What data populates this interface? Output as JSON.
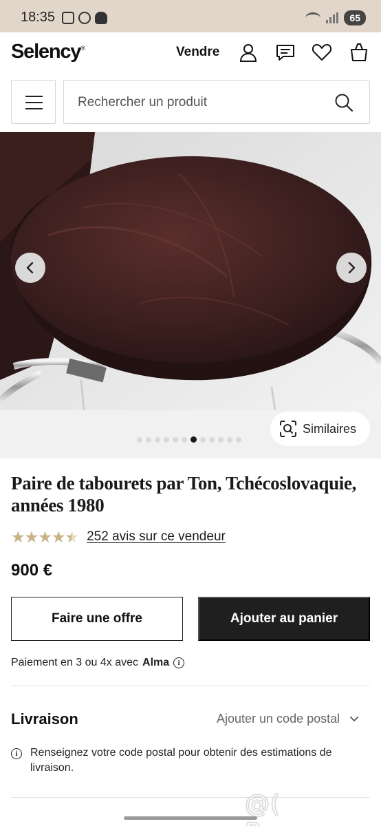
{
  "status_bar": {
    "time": "18:35",
    "battery": "65"
  },
  "header": {
    "logo": "Selency",
    "logo_mark": "®",
    "sell_label": "Vendre"
  },
  "search": {
    "placeholder": "Rechercher un produit"
  },
  "gallery": {
    "image_count": 12,
    "active_index": 6,
    "similar_label": "Similaires"
  },
  "product": {
    "title": "Paire de tabourets par Ton, Tchécoslovaquie, années 1980",
    "rating": 4.5,
    "stars": "★★★★★",
    "reviews_label": "252 avis sur ce vendeur",
    "price": "900 €"
  },
  "actions": {
    "offer_label": "Faire une offre",
    "cart_label": "Ajouter au panier"
  },
  "payment": {
    "text": "Paiement en 3 ou 4x avec",
    "brand": "Alma"
  },
  "delivery": {
    "title": "Livraison",
    "postal_link": "Ajouter un code postal",
    "note": "Renseignez votre code postal pour obtenir des estimations de livraison."
  },
  "watermark": "@( Bazos.cz",
  "colors": {
    "star": "#c9b283",
    "cart_button": "#1f1f1f",
    "status_bar": "#e2d6cb"
  }
}
